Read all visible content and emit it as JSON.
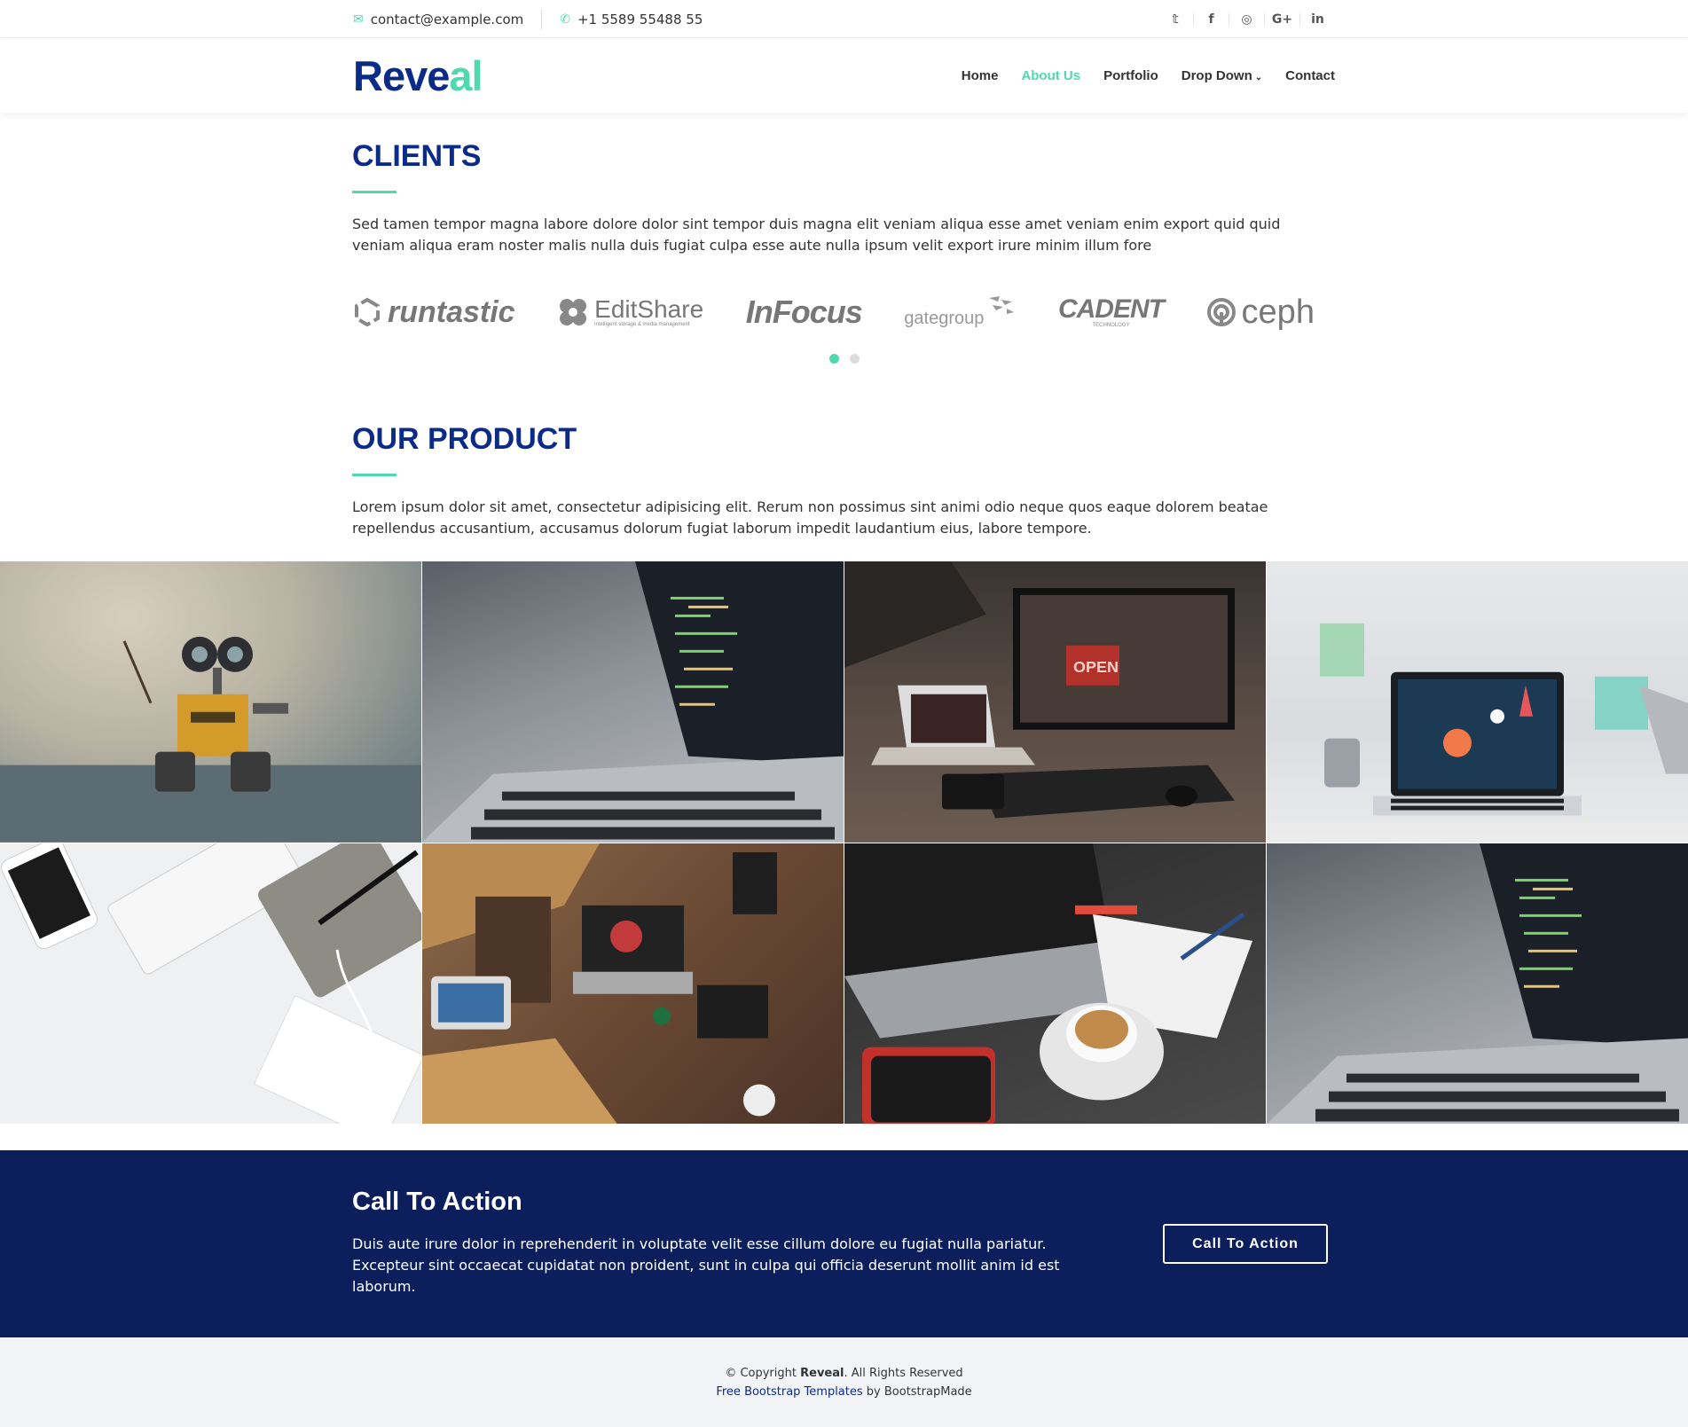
{
  "topbar": {
    "email": "contact@example.com",
    "phone": "+1 5589 55488 55",
    "social": [
      {
        "icon": "twitter-icon",
        "glyph": "𝕥"
      },
      {
        "icon": "facebook-icon",
        "glyph": "f"
      },
      {
        "icon": "instagram-icon",
        "glyph": "◎"
      },
      {
        "icon": "google-plus-icon",
        "glyph": "G+"
      },
      {
        "icon": "linkedin-icon",
        "glyph": "in"
      }
    ]
  },
  "header": {
    "logo_main": "Reve",
    "logo_accent": "al",
    "nav": [
      {
        "label": "Home",
        "active": false
      },
      {
        "label": "About Us",
        "active": true
      },
      {
        "label": "Portfolio",
        "active": false
      },
      {
        "label": "Drop Down",
        "active": false,
        "dropdown": true
      },
      {
        "label": "Contact",
        "active": false
      }
    ]
  },
  "clients": {
    "title": "CLIENTS",
    "description": "Sed tamen tempor magna labore dolore dolor sint tempor duis magna elit veniam aliqua esse amet veniam enim export quid quid veniam aliqua eram noster malis nulla duis fugiat culpa esse aute nulla ipsum velit export irure minim illum fore",
    "logos": [
      "runtastic",
      "EditShare",
      "InFocus",
      "gategroup",
      "CADENT",
      "ceph"
    ],
    "logo_sublabels": [
      "intelligent storage & media management",
      "TECHNOLOGY"
    ],
    "carousel_pages": 2,
    "carousel_active": 0
  },
  "product": {
    "title": "OUR PRODUCT",
    "description": "Lorem ipsum dolor sit amet, consectetur adipisicing elit. Rerum non possimus sint animi odio neque quos eaque dolorem beatae repellendus accusantium, accusamus dolorum fugiat laborum impedit laudantium eius, labore tempore.",
    "gallery": [
      {
        "name": "robot-photo"
      },
      {
        "name": "laptop-code-photo"
      },
      {
        "name": "desk-monitor-photo",
        "sign_text": "OPEN"
      },
      {
        "name": "laptop-dashboard-photo"
      },
      {
        "name": "keyboard-phone-photo"
      },
      {
        "name": "workspace-desk-photo"
      },
      {
        "name": "coffee-laptop-photo"
      },
      {
        "name": "laptop-code-photo-2"
      }
    ]
  },
  "cta": {
    "title": "Call To Action",
    "text": "Duis aute irure dolor in reprehenderit in voluptate velit esse cillum dolore eu fugiat nulla pariatur. Excepteur sint occaecat cupidatat non proident, sunt in culpa qui officia deserunt mollit anim id est laborum.",
    "button": "Call To Action"
  },
  "footer": {
    "copyright_prefix": "© Copyright ",
    "brand": "Reveal",
    "copyright_suffix": ". All Rights Reserved",
    "link_text": "Free Bootstrap Templates",
    "by_text": " by BootstrapMade"
  },
  "colors": {
    "brand_navy": "#0b2b88",
    "accent_teal": "#50d8af",
    "cta_bg": "#0c1f5c",
    "footer_bg": "#f2f4f7"
  }
}
